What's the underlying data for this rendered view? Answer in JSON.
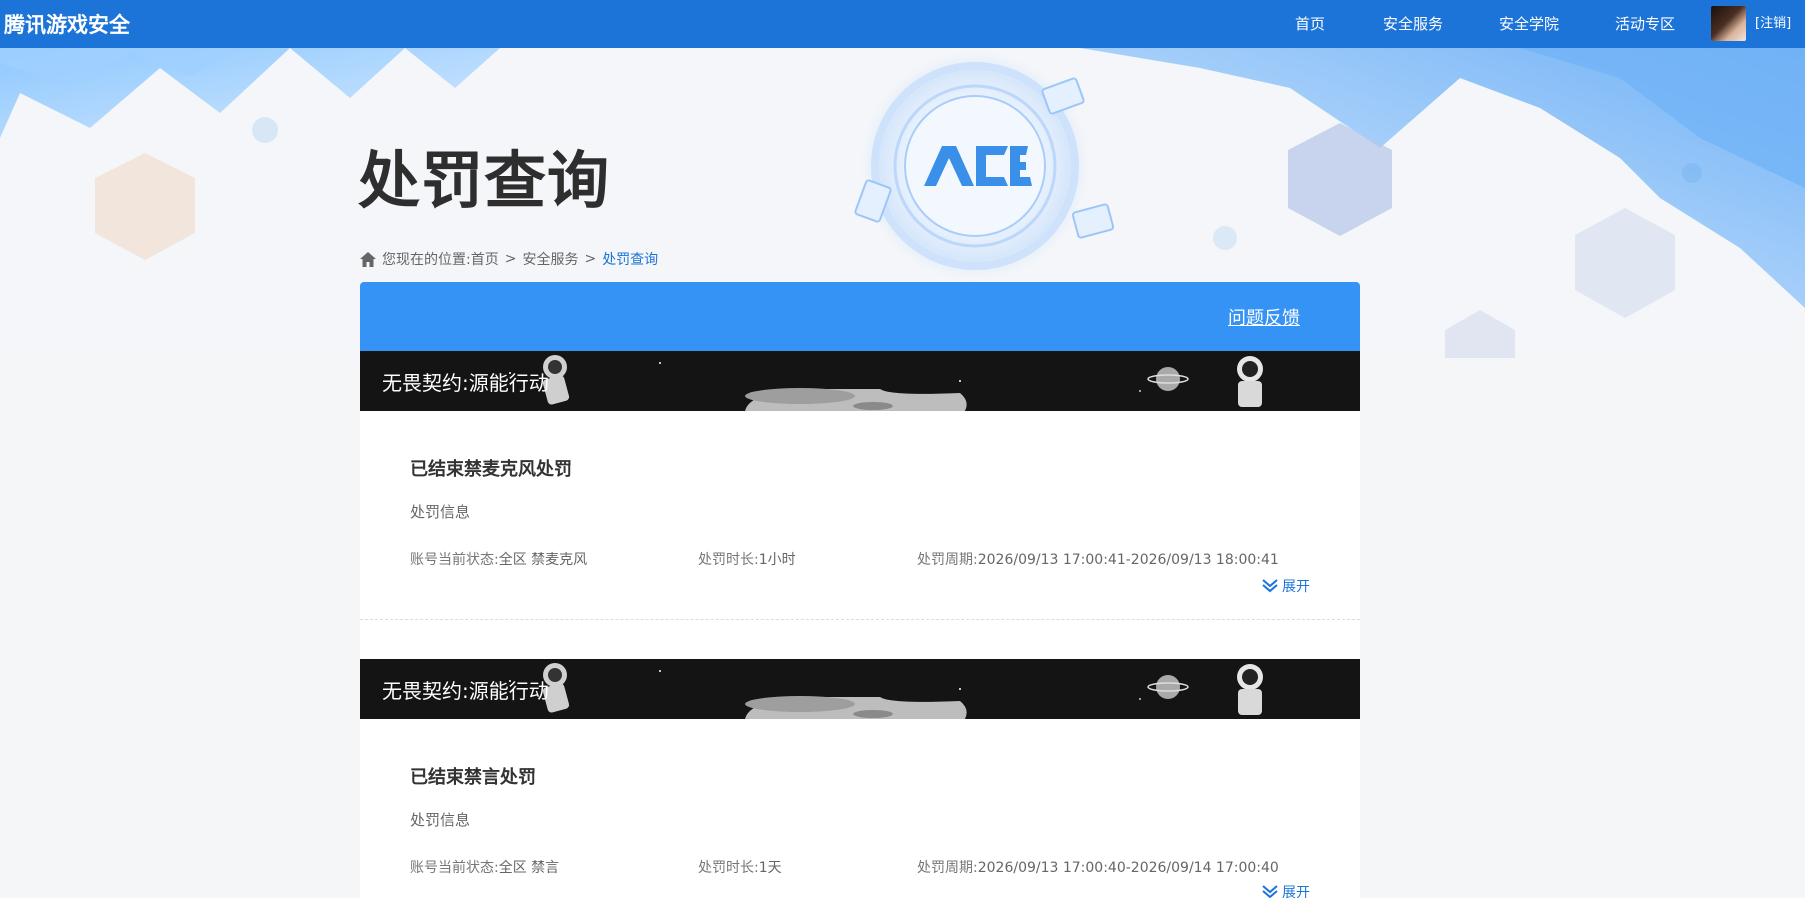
{
  "header": {
    "logo": "腾讯游戏安全",
    "nav": [
      "首页",
      "安全服务",
      "安全学院",
      "活动专区"
    ],
    "logout": "[注销]"
  },
  "page": {
    "title": "处罚查询"
  },
  "breadcrumb": {
    "prefix": "您现在的位置:",
    "items": [
      "首页",
      "安全服务",
      "处罚查询"
    ],
    "separator": ">"
  },
  "panel": {
    "feedback": "问题反馈"
  },
  "records": [
    {
      "game": "无畏契约:源能行动",
      "title": "已结束禁麦克风处罚",
      "section": "处罚信息",
      "status_label": "账号当前状态:",
      "status_value": "全区 禁麦克风",
      "duration_label": "处罚时长:",
      "duration_value": "1小时",
      "period_label": "处罚周期:",
      "period_value": "2026/09/13 17:00:41-2026/09/13 18:00:41",
      "expand": "展开"
    },
    {
      "game": "无畏契约:源能行动",
      "title": "已结束禁言处罚",
      "section": "处罚信息",
      "status_label": "账号当前状态:",
      "status_value": "全区 禁言",
      "duration_label": "处罚时长:",
      "duration_value": "1天",
      "period_label": "处罚周期:",
      "period_value": "2026/09/13 17:00:40-2026/09/14 17:00:40",
      "expand": "展开"
    }
  ],
  "colors": {
    "topbar": "#1c74d8",
    "panel_header": "#3493f5",
    "link": "#1c74d8"
  },
  "icons": [
    "home-icon",
    "chevron-double-down-icon",
    "ace-logo"
  ]
}
